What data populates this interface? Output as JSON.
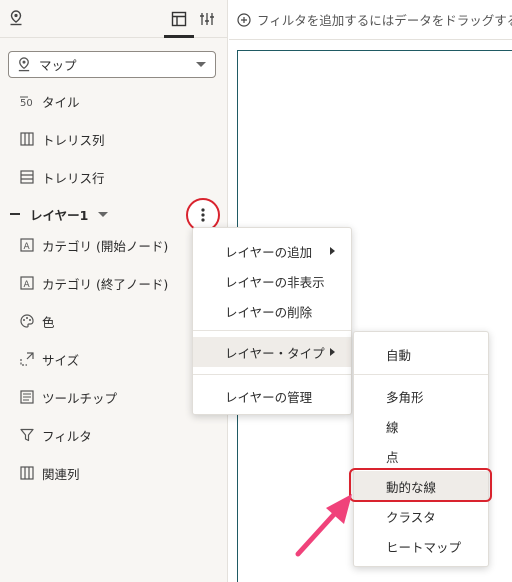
{
  "left_panel": {
    "visualization_select": {
      "value": "マップ"
    },
    "properties": [
      {
        "label": "タイル",
        "icon": "tile-icon"
      },
      {
        "label": "トレリス列",
        "icon": "trellis-columns-icon"
      },
      {
        "label": "トレリス行",
        "icon": "trellis-rows-icon"
      }
    ],
    "layer": {
      "label": "レイヤー1"
    },
    "layer_properties": [
      {
        "label": "カテゴリ (開始ノード)",
        "icon": "category-icon"
      },
      {
        "label": "カテゴリ (終了ノード)",
        "icon": "category-icon"
      },
      {
        "label": "色",
        "icon": "palette-icon"
      },
      {
        "label": "サイズ",
        "icon": "size-icon"
      },
      {
        "label": "ツールチップ",
        "icon": "tooltip-icon"
      },
      {
        "label": "フィルタ",
        "icon": "filter-icon"
      },
      {
        "label": "関連列",
        "icon": "related-columns-icon"
      }
    ]
  },
  "filter_bar": {
    "text": "フィルタを追加するにはデータをドラッグするか"
  },
  "context_menu": {
    "items": [
      {
        "label": "レイヤーの追加"
      },
      {
        "label": "レイヤーの非表示"
      },
      {
        "label": "レイヤーの削除"
      },
      {
        "label": "レイヤー・タイプ"
      },
      {
        "label": "レイヤーの管理"
      }
    ]
  },
  "layer_type_menu": {
    "items": [
      {
        "label": "自動"
      },
      {
        "label": "多角形"
      },
      {
        "label": "線"
      },
      {
        "label": "点"
      },
      {
        "label": "動的な線"
      },
      {
        "label": "クラスタ"
      },
      {
        "label": "ヒートマップ"
      }
    ]
  },
  "colors": {
    "highlight": "#d9232e",
    "arrow": "#f0427a",
    "canvas_border": "#1f5a63"
  }
}
